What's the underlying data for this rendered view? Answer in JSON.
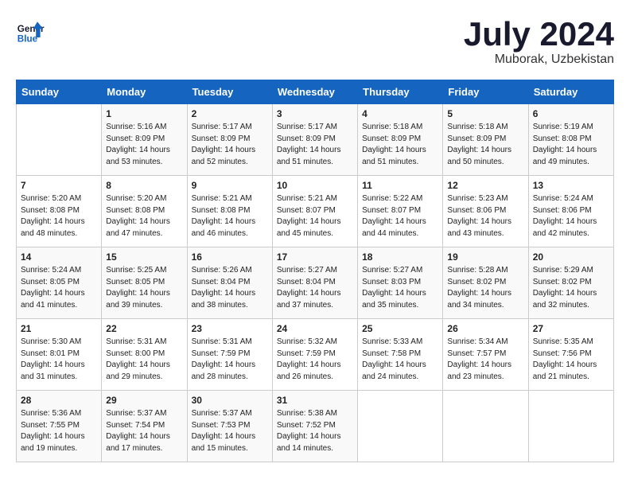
{
  "header": {
    "logo_line1": "General",
    "logo_line2": "Blue",
    "month_title": "July 2024",
    "location": "Muborak, Uzbekistan"
  },
  "days_of_week": [
    "Sunday",
    "Monday",
    "Tuesday",
    "Wednesday",
    "Thursday",
    "Friday",
    "Saturday"
  ],
  "weeks": [
    [
      {
        "day": "",
        "info": ""
      },
      {
        "day": "1",
        "info": "Sunrise: 5:16 AM\nSunset: 8:09 PM\nDaylight: 14 hours\nand 53 minutes."
      },
      {
        "day": "2",
        "info": "Sunrise: 5:17 AM\nSunset: 8:09 PM\nDaylight: 14 hours\nand 52 minutes."
      },
      {
        "day": "3",
        "info": "Sunrise: 5:17 AM\nSunset: 8:09 PM\nDaylight: 14 hours\nand 51 minutes."
      },
      {
        "day": "4",
        "info": "Sunrise: 5:18 AM\nSunset: 8:09 PM\nDaylight: 14 hours\nand 51 minutes."
      },
      {
        "day": "5",
        "info": "Sunrise: 5:18 AM\nSunset: 8:09 PM\nDaylight: 14 hours\nand 50 minutes."
      },
      {
        "day": "6",
        "info": "Sunrise: 5:19 AM\nSunset: 8:08 PM\nDaylight: 14 hours\nand 49 minutes."
      }
    ],
    [
      {
        "day": "7",
        "info": "Sunrise: 5:20 AM\nSunset: 8:08 PM\nDaylight: 14 hours\nand 48 minutes."
      },
      {
        "day": "8",
        "info": "Sunrise: 5:20 AM\nSunset: 8:08 PM\nDaylight: 14 hours\nand 47 minutes."
      },
      {
        "day": "9",
        "info": "Sunrise: 5:21 AM\nSunset: 8:08 PM\nDaylight: 14 hours\nand 46 minutes."
      },
      {
        "day": "10",
        "info": "Sunrise: 5:21 AM\nSunset: 8:07 PM\nDaylight: 14 hours\nand 45 minutes."
      },
      {
        "day": "11",
        "info": "Sunrise: 5:22 AM\nSunset: 8:07 PM\nDaylight: 14 hours\nand 44 minutes."
      },
      {
        "day": "12",
        "info": "Sunrise: 5:23 AM\nSunset: 8:06 PM\nDaylight: 14 hours\nand 43 minutes."
      },
      {
        "day": "13",
        "info": "Sunrise: 5:24 AM\nSunset: 8:06 PM\nDaylight: 14 hours\nand 42 minutes."
      }
    ],
    [
      {
        "day": "14",
        "info": "Sunrise: 5:24 AM\nSunset: 8:05 PM\nDaylight: 14 hours\nand 41 minutes."
      },
      {
        "day": "15",
        "info": "Sunrise: 5:25 AM\nSunset: 8:05 PM\nDaylight: 14 hours\nand 39 minutes."
      },
      {
        "day": "16",
        "info": "Sunrise: 5:26 AM\nSunset: 8:04 PM\nDaylight: 14 hours\nand 38 minutes."
      },
      {
        "day": "17",
        "info": "Sunrise: 5:27 AM\nSunset: 8:04 PM\nDaylight: 14 hours\nand 37 minutes."
      },
      {
        "day": "18",
        "info": "Sunrise: 5:27 AM\nSunset: 8:03 PM\nDaylight: 14 hours\nand 35 minutes."
      },
      {
        "day": "19",
        "info": "Sunrise: 5:28 AM\nSunset: 8:02 PM\nDaylight: 14 hours\nand 34 minutes."
      },
      {
        "day": "20",
        "info": "Sunrise: 5:29 AM\nSunset: 8:02 PM\nDaylight: 14 hours\nand 32 minutes."
      }
    ],
    [
      {
        "day": "21",
        "info": "Sunrise: 5:30 AM\nSunset: 8:01 PM\nDaylight: 14 hours\nand 31 minutes."
      },
      {
        "day": "22",
        "info": "Sunrise: 5:31 AM\nSunset: 8:00 PM\nDaylight: 14 hours\nand 29 minutes."
      },
      {
        "day": "23",
        "info": "Sunrise: 5:31 AM\nSunset: 7:59 PM\nDaylight: 14 hours\nand 28 minutes."
      },
      {
        "day": "24",
        "info": "Sunrise: 5:32 AM\nSunset: 7:59 PM\nDaylight: 14 hours\nand 26 minutes."
      },
      {
        "day": "25",
        "info": "Sunrise: 5:33 AM\nSunset: 7:58 PM\nDaylight: 14 hours\nand 24 minutes."
      },
      {
        "day": "26",
        "info": "Sunrise: 5:34 AM\nSunset: 7:57 PM\nDaylight: 14 hours\nand 23 minutes."
      },
      {
        "day": "27",
        "info": "Sunrise: 5:35 AM\nSunset: 7:56 PM\nDaylight: 14 hours\nand 21 minutes."
      }
    ],
    [
      {
        "day": "28",
        "info": "Sunrise: 5:36 AM\nSunset: 7:55 PM\nDaylight: 14 hours\nand 19 minutes."
      },
      {
        "day": "29",
        "info": "Sunrise: 5:37 AM\nSunset: 7:54 PM\nDaylight: 14 hours\nand 17 minutes."
      },
      {
        "day": "30",
        "info": "Sunrise: 5:37 AM\nSunset: 7:53 PM\nDaylight: 14 hours\nand 15 minutes."
      },
      {
        "day": "31",
        "info": "Sunrise: 5:38 AM\nSunset: 7:52 PM\nDaylight: 14 hours\nand 14 minutes."
      },
      {
        "day": "",
        "info": ""
      },
      {
        "day": "",
        "info": ""
      },
      {
        "day": "",
        "info": ""
      }
    ]
  ]
}
